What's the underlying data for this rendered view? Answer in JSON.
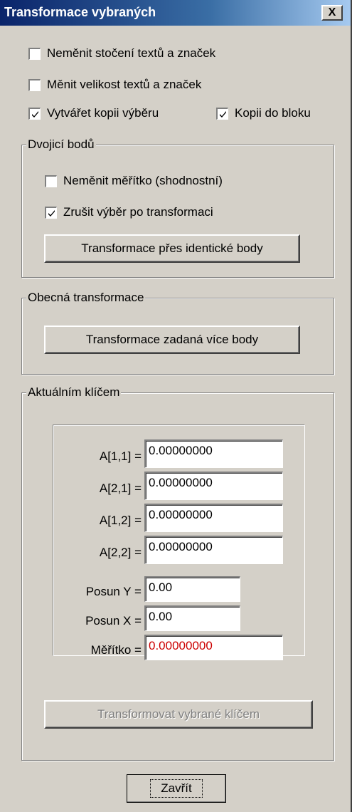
{
  "window": {
    "title": "Transformace vybraných",
    "close_glyph": "X"
  },
  "options": {
    "keep_rotation": {
      "label": "Neměnit stočení textů a značek",
      "checked": false
    },
    "change_size": {
      "label": "Měnit velikost textů a značek",
      "checked": false
    },
    "create_copy": {
      "label": "Vytvářet kopii výběru",
      "checked": true
    },
    "copy_to_block": {
      "label": "Kopii do bloku",
      "checked": true
    }
  },
  "pair_group": {
    "title": "Dvojicí bodů",
    "keep_scale": {
      "label": "Neměnit měřítko (shodnostní)",
      "checked": false
    },
    "clear_selection": {
      "label": "Zrušit výběr po transformaci",
      "checked": true
    },
    "button": "Transformace přes identické body"
  },
  "general_group": {
    "title": "Obecná transformace",
    "button": "Transformace zadaná více body"
  },
  "key_group": {
    "title": "Aktuálním klíčem",
    "fields": [
      {
        "label": "A[1,1] =",
        "value": "0.00000000"
      },
      {
        "label": "A[2,1] =",
        "value": "0.00000000"
      },
      {
        "label": "A[1,2] =",
        "value": "0.00000000"
      },
      {
        "label": "A[2,2] =",
        "value": "0.00000000"
      },
      {
        "label": "Posun Y =",
        "value": "0.00"
      },
      {
        "label": "Posun X =",
        "value": "0.00"
      },
      {
        "label": "Měřítko =",
        "value": "0.00000000"
      }
    ],
    "button": "Transformovat vybrané klíčem"
  },
  "footer": {
    "close_button": "Zavřít"
  },
  "colors": {
    "face": "#d4d0c8",
    "title_start": "#0a246a",
    "scale_value": "#cc0000",
    "disabled_text": "#808080"
  }
}
